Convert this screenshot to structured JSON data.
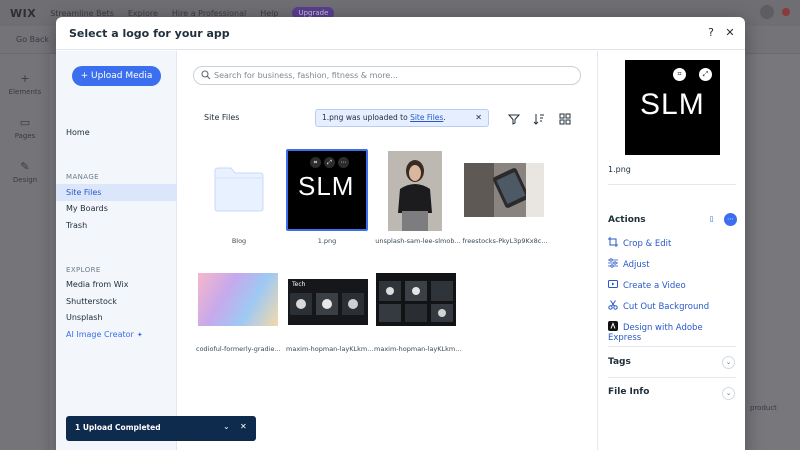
{
  "background_editor": {
    "logo": "WIX",
    "menu": [
      "Streamline Bets",
      "Explore",
      "Hire a Professional",
      "Help"
    ],
    "pill": "Upgrade",
    "back": "Go Back",
    "sidebar": [
      "Elements",
      "Pages",
      "Design"
    ],
    "frag_product": "product"
  },
  "modal": {
    "title": "Select a logo for your app",
    "help_glyph": "?",
    "close_glyph": "✕"
  },
  "leftnav": {
    "upload_label": "+ Upload Media",
    "home": "Home",
    "manage_heading": "MANAGE",
    "manage_items": [
      "Site Files",
      "My Boards",
      "Trash"
    ],
    "explore_heading": "EXPLORE",
    "explore_items": [
      "Media from Wix",
      "Shutterstock",
      "Unsplash"
    ],
    "ai_item": "AI Image Creator"
  },
  "main": {
    "search_placeholder": "Search for business, fashion, fitness & more...",
    "breadcrumb": "Site Files",
    "toast": {
      "prefix": "1.png was uploaded to ",
      "link": "Site Files",
      "suffix": ".",
      "close": "✕"
    },
    "files": [
      {
        "label": "Blog",
        "kind": "folder"
      },
      {
        "label": "1.png",
        "kind": "logo",
        "selected": true,
        "logo_text": "SLM"
      },
      {
        "label": "unsplash-sam-lee-slmob...",
        "kind": "person"
      },
      {
        "label": "freestocks-PkyL3p9Kx8c...",
        "kind": "tablet"
      },
      {
        "label": "codioful-formerly-gradie...",
        "kind": "gradient"
      },
      {
        "label": "maxim-hopman-layKLkm...",
        "kind": "screens",
        "overlay_text": "Tech"
      },
      {
        "label": "maxim-hopman-layKLkm...",
        "kind": "screens2"
      }
    ]
  },
  "rpanel": {
    "preview_text": "SLM",
    "filename": "1.png",
    "actions_heading": "Actions",
    "actions": [
      "Crop & Edit",
      "Adjust",
      "Create a Video",
      "Cut Out Background",
      "Design with Adobe Express"
    ],
    "tags_heading": "Tags",
    "fileinfo_heading": "File Info"
  },
  "upload_bar": {
    "text": "1 Upload Completed"
  },
  "colors": {
    "accent": "#3b6fef",
    "link": "#2958c9",
    "upload_bar": "#0e2a4d"
  }
}
